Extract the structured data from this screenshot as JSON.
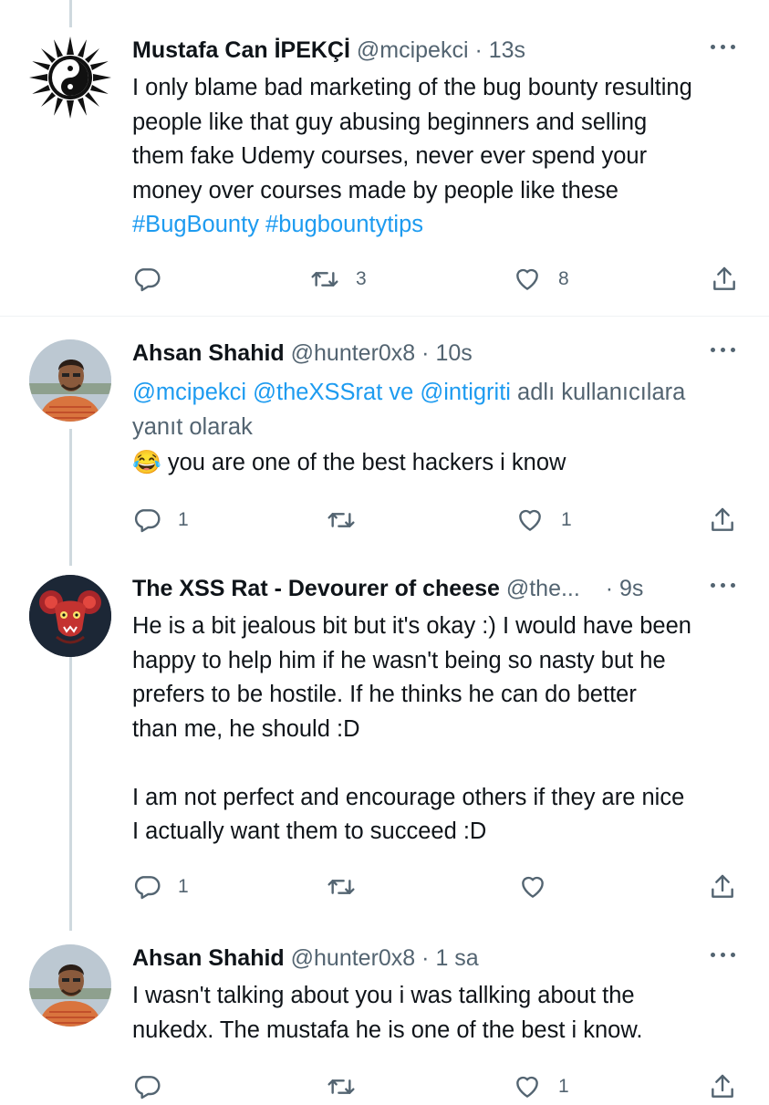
{
  "tweets": [
    {
      "name": "Mustafa Can İPEKÇİ",
      "handle": "@mcipekci",
      "time": "13s",
      "text_lines": [
        "I only blame bad marketing of the bug bounty resulting",
        "people like that guy abusing beginners and selling",
        "them fake Udemy courses, never ever spend your",
        "money over courses made by people like these"
      ],
      "hashtags": [
        "#BugBounty",
        "#bugbountytips"
      ],
      "replies": "",
      "retweets": "3",
      "likes": "8"
    },
    {
      "name": "Ahsan Shahid",
      "handle": "@hunter0x8",
      "time": "10s",
      "reply_mentions": "@mcipekci @theXSSrat ve @intigriti",
      "reply_suffix": "adlı kullanıcılara",
      "reply_line2": "yanıt olarak",
      "emoji": "😂",
      "text": "you are one of the best hackers i know",
      "replies": "1",
      "retweets": "",
      "likes": "1"
    },
    {
      "name": "The XSS Rat - Devourer of cheese",
      "handle": "@the...",
      "time": "9s",
      "text_lines": [
        "He is a bit jealous bit but it's okay :) I would have been",
        "happy to help him if he wasn't being so nasty but he",
        "prefers to be hostile. If he thinks he can do better",
        "than me, he should :D",
        "",
        "I am not perfect and encourage others if they are nice",
        "I actually want them to succeed :D"
      ],
      "replies": "1",
      "retweets": "",
      "likes": ""
    },
    {
      "name": "Ahsan Shahid",
      "handle": "@hunter0x8",
      "time": "1 sa",
      "text_lines": [
        "I wasn't talking about you i was tallking about the",
        "nukedx. The mustafa he is one of the best i know."
      ],
      "replies": "",
      "retweets": "",
      "likes": "1"
    }
  ],
  "separator": "·",
  "icons": [
    "more-icon",
    "reply-icon",
    "retweet-icon",
    "like-icon",
    "share-icon",
    "yin-yang-sun-avatar",
    "rat-avatar",
    "person-avatar"
  ],
  "colors": {
    "link": "#1d9bf0",
    "secondary": "#536471",
    "thread_line": "#cfd9de"
  }
}
